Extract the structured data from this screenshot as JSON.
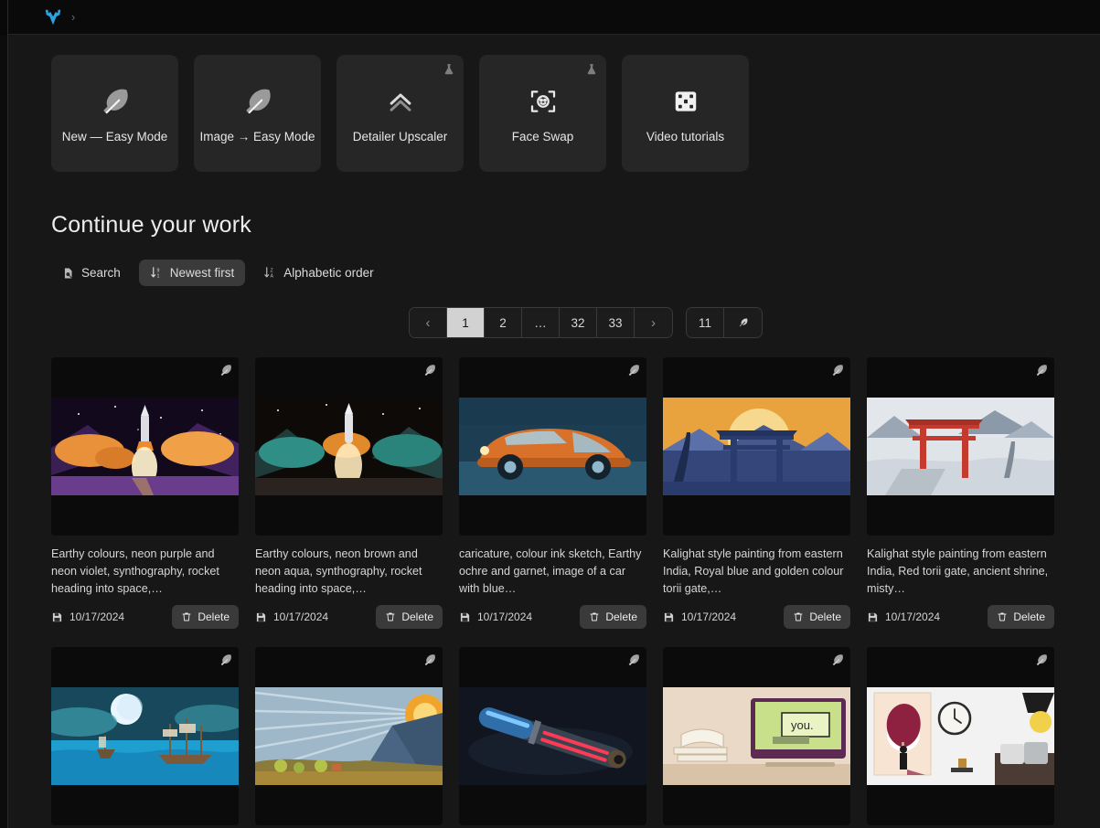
{
  "topbar": {
    "logo_icon": "antler-logo-icon",
    "breadcrumb_chevron": "›"
  },
  "action_cards": [
    {
      "label": "New — Easy Mode",
      "icon": "feather-icon",
      "experimental": false
    },
    {
      "label": "Image → Easy Mode",
      "icon": "feather-icon",
      "experimental": false
    },
    {
      "label": "Detailer Upscaler",
      "icon": "double-chevron-up-icon",
      "experimental": true
    },
    {
      "label": "Face Swap",
      "icon": "face-scan-icon",
      "experimental": true
    },
    {
      "label": "Video tutorials",
      "icon": "film-strip-icon",
      "experimental": false
    }
  ],
  "section": {
    "title": "Continue your work"
  },
  "filters": [
    {
      "label": "Search",
      "icon": "page-search-icon",
      "active": false
    },
    {
      "label": "Newest first",
      "icon": "sort-descending-icon",
      "active": true
    },
    {
      "label": "Alphabetic order",
      "icon": "sort-alpha-icon",
      "active": false
    }
  ],
  "pagination": {
    "prev_icon": "chevron-left-icon",
    "next_icon": "chevron-right-icon",
    "pages": [
      "1",
      "2",
      "…",
      "32",
      "33"
    ],
    "active_page": "1",
    "jump_value": "11",
    "jump_icon": "go-arrow-icon"
  },
  "gallery": {
    "save_icon": "floppy-save-icon",
    "delete_icon": "trash-icon",
    "delete_label": "Delete",
    "badge_icon": "feather-icon",
    "items": [
      {
        "caption": "Earthy colours, neon purple and neon violet, synthography, rocket heading into space,…",
        "date": "10/17/2024",
        "art": "rocket-purple"
      },
      {
        "caption": "Earthy colours, neon brown and neon aqua, synthography, rocket heading into space,…",
        "date": "10/17/2024",
        "art": "rocket-aqua"
      },
      {
        "caption": "caricature, colour ink sketch, Earthy ochre and garnet, image of a car with blue…",
        "date": "10/17/2024",
        "art": "orange-car"
      },
      {
        "caption": "Kalighat style painting from eastern India, Royal blue and golden colour torii gate,…",
        "date": "10/17/2024",
        "art": "torii-blue"
      },
      {
        "caption": "Kalighat style painting from eastern India, Red torii gate, ancient shrine, misty…",
        "date": "10/17/2024",
        "art": "torii-red"
      },
      {
        "caption": "",
        "date": "",
        "art": "moon-ship"
      },
      {
        "caption": "",
        "date": "",
        "art": "volcano-sun"
      },
      {
        "caption": "",
        "date": "",
        "art": "lightsaber"
      },
      {
        "caption": "",
        "date": "",
        "art": "desk-monitor"
      },
      {
        "caption": "",
        "date": "",
        "art": "wall-art"
      }
    ]
  },
  "colors": {
    "page_bg": "#171717",
    "card_bg": "#262626",
    "chip_active_bg": "#3a3a3a",
    "accent_logo": "#2aa3e0",
    "pager_active_bg": "#d2d2d2"
  }
}
